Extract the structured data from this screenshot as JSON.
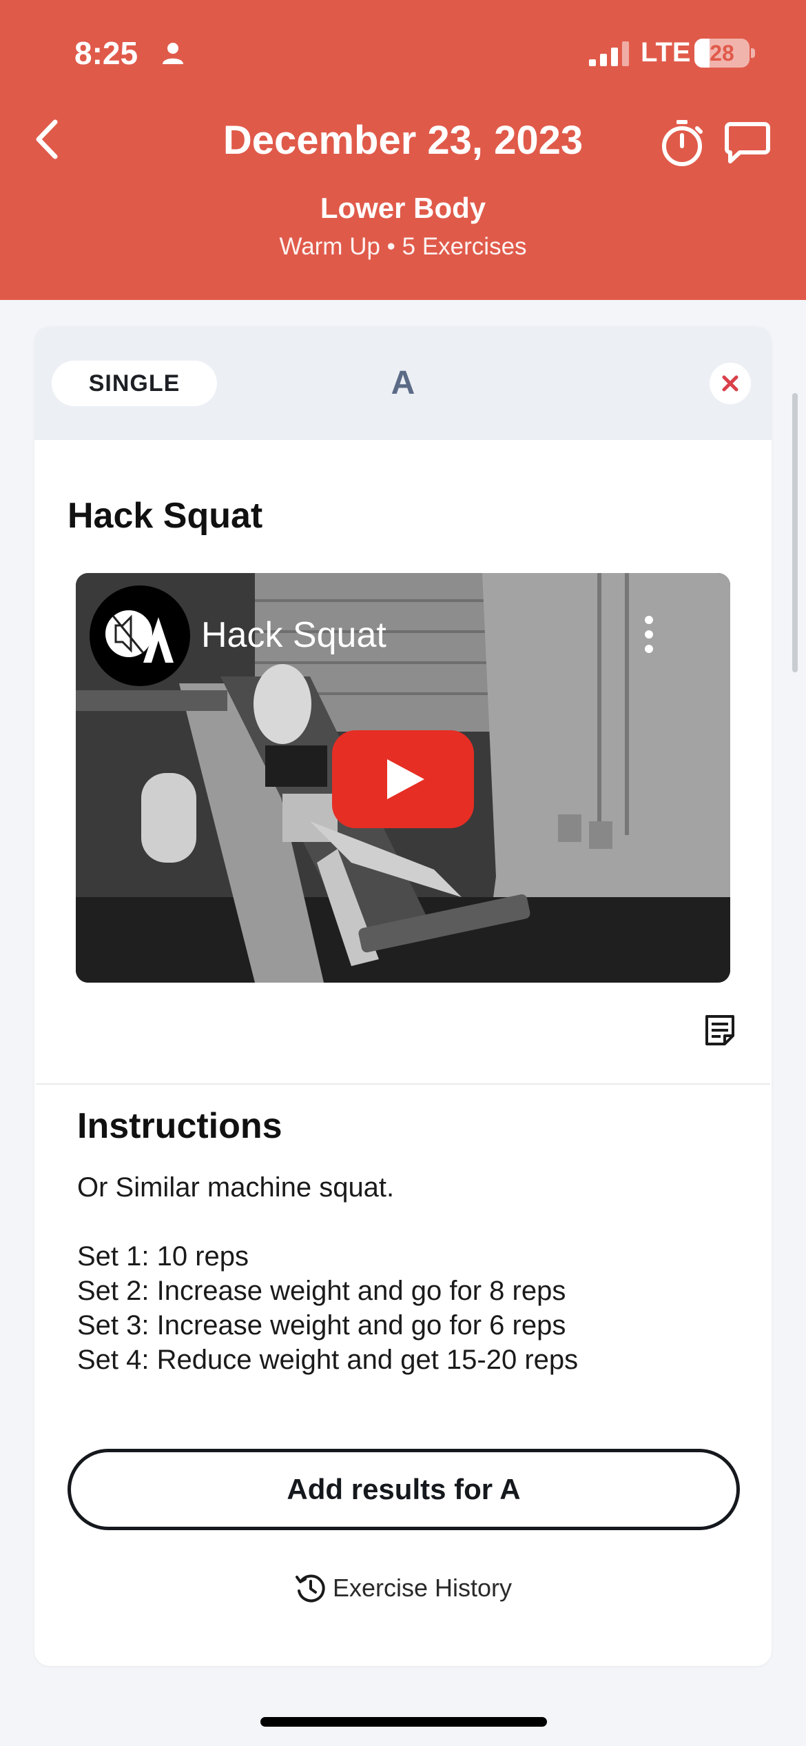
{
  "status_bar": {
    "time": "8:25",
    "network": "LTE",
    "battery": "28",
    "battery_level": 0.28
  },
  "header": {
    "date": "December 23, 2023",
    "workout_name": "Lower Body",
    "subtitle": "Warm Up • 5 Exercises",
    "background": "#e05a4a"
  },
  "card": {
    "type_pill": "SINGLE",
    "section_letter": "A",
    "exercise_name": "Hack Squat",
    "video": {
      "title": "Hack Squat"
    },
    "instructions_title": "Instructions",
    "instructions_text": "Or Similar machine squat.\n\nSet 1: 10 reps\nSet 2: Increase weight and go for 8 reps\nSet 3: Increase weight and go for 6 reps\nSet 4: Reduce weight and get 15-20 reps",
    "add_results_label": "Add results for A",
    "history_label": "Exercise History"
  },
  "colors": {
    "accent": "#e05a4a",
    "close_x": "#d9404a",
    "play_red": "#e62e24"
  },
  "icons": [
    "person-icon",
    "signal-icon",
    "back-chevron-icon",
    "stopwatch-icon",
    "chat-icon",
    "close-icon",
    "mute-icon",
    "more-vertical-icon",
    "play-icon",
    "notes-icon",
    "history-icon"
  ]
}
